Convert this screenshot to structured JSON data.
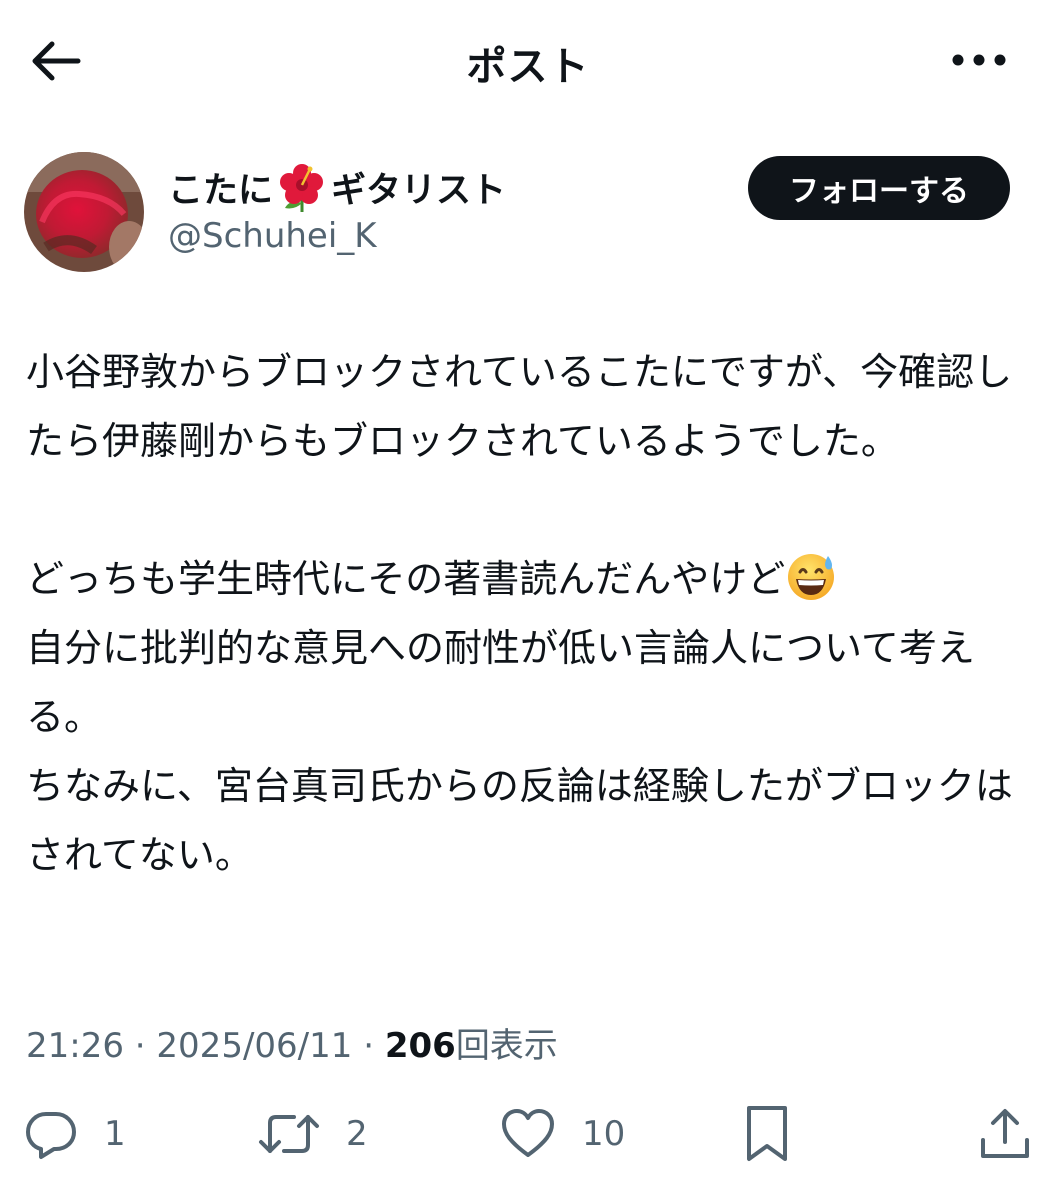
{
  "header": {
    "title": "ポスト",
    "back_icon": "arrow-left-icon",
    "more_icon": "more-horizontal-icon"
  },
  "author": {
    "display_name": "こたに",
    "display_name_suffix": "ギタリスト",
    "handle": "@Schuhei_K",
    "name_emoji": "hibiscus-icon",
    "follow_label": "フォローする"
  },
  "post": {
    "paragraph1": "小谷野敦からブロックされているこたにですが、今確認したら伊藤剛からもブロックされているようでした。",
    "paragraph2_line1": "どっちも学生時代にその著書読んだんやけど",
    "paragraph2_emoji": "grinning-sweat-icon",
    "paragraph2_rest": "自分に批判的な意見への耐性が低い言論人について考える。\nちなみに、宮台真司氏からの反論は経験したがブロックはされてない。"
  },
  "meta": {
    "time": "21:26",
    "separator": " · ",
    "date": "2025/06/11",
    "views_count": "206",
    "views_label": "回表示"
  },
  "actions": {
    "reply_count": "1",
    "repost_count": "2",
    "like_count": "10"
  },
  "colors": {
    "text": "#0f1419",
    "secondary": "#536471",
    "button": "#0f1419"
  }
}
